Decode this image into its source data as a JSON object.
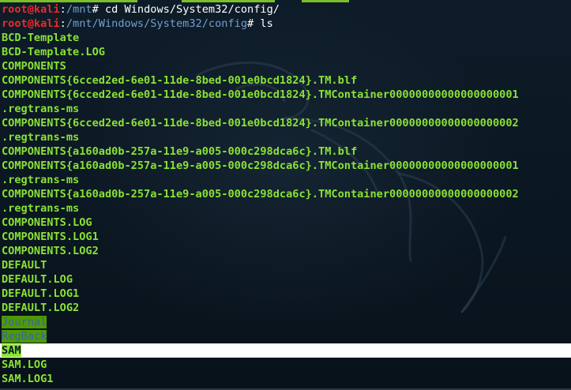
{
  "terminal": {
    "accent_color": "#8ae234",
    "prompt_user_color": "#ef2929",
    "path_color": "#729fcf",
    "prompts": [
      {
        "user": "root@kali",
        "sep": ":",
        "path": "/mnt",
        "sym": "#",
        "command": " cd Windows/System32/config/"
      },
      {
        "user": "root@kali",
        "sep": ":",
        "path": "/mnt/Windows/System32/config",
        "sym": "#",
        "command": " ls"
      }
    ],
    "listing": [
      "BCD-Template",
      "BCD-Template.LOG",
      "COMPONENTS",
      "COMPONENTS{6cced2ed-6e01-11de-8bed-001e0bcd1824}.TM.blf",
      "COMPONENTS{6cced2ed-6e01-11de-8bed-001e0bcd1824}.TMContainer00000000000000000001",
      ".regtrans-ms",
      "COMPONENTS{6cced2ed-6e01-11de-8bed-001e0bcd1824}.TMContainer00000000000000000002",
      ".regtrans-ms",
      "COMPONENTS{a160ad0b-257a-11e9-a005-000c298dca6c}.TM.blf",
      "COMPONENTS{a160ad0b-257a-11e9-a005-000c298dca6c}.TMContainer00000000000000000001",
      ".regtrans-ms",
      "COMPONENTS{a160ad0b-257a-11e9-a005-000c298dca6c}.TMContainer00000000000000000002",
      ".regtrans-ms",
      "COMPONENTS.LOG",
      "COMPONENTS.LOG1",
      "COMPONENTS.LOG2",
      "DEFAULT",
      "DEFAULT.LOG",
      "DEFAULT.LOG1",
      "DEFAULT.LOG2",
      "Journal",
      "RegBack",
      "SAM",
      "SAM.LOG",
      "SAM.LOG1"
    ]
  }
}
